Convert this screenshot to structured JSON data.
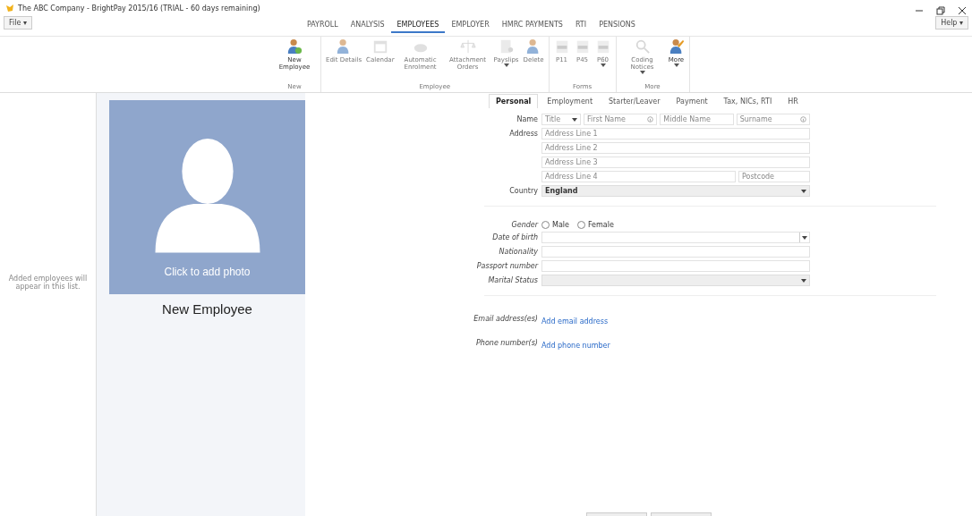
{
  "window": {
    "title": "The ABC Company - BrightPay 2015/16 (TRIAL - 60 days remaining)"
  },
  "file_menu": "File ▾",
  "help_menu": "Help ▾",
  "ribbon_tabs": [
    {
      "label": "PAYROLL",
      "selected": false
    },
    {
      "label": "ANALYSIS",
      "selected": false
    },
    {
      "label": "EMPLOYEES",
      "selected": true
    },
    {
      "label": "EMPLOYER",
      "selected": false
    },
    {
      "label": "HMRC PAYMENTS",
      "selected": false
    },
    {
      "label": "RTI",
      "selected": false
    },
    {
      "label": "PENSIONS",
      "selected": false
    }
  ],
  "ribbon_groups": [
    {
      "label": "New",
      "items": [
        {
          "label": "New Employee",
          "disabled": false,
          "dropdown": false
        }
      ]
    },
    {
      "label": "Employee",
      "items": [
        {
          "label": "Edit Details",
          "disabled": true,
          "dropdown": false
        },
        {
          "label": "Calendar",
          "disabled": true,
          "dropdown": false
        },
        {
          "label": "Automatic Enrolment",
          "disabled": true,
          "dropdown": false
        },
        {
          "label": "Attachment Orders",
          "disabled": true,
          "dropdown": false
        },
        {
          "label": "Payslips",
          "disabled": true,
          "dropdown": true
        },
        {
          "label": "Delete",
          "disabled": true,
          "dropdown": false
        }
      ]
    },
    {
      "label": "Forms",
      "items": [
        {
          "label": "P11",
          "disabled": true,
          "dropdown": false
        },
        {
          "label": "P45",
          "disabled": true,
          "dropdown": false
        },
        {
          "label": "P60",
          "disabled": true,
          "dropdown": true
        }
      ]
    },
    {
      "label": "More",
      "items": [
        {
          "label": "Coding Notices",
          "disabled": true,
          "dropdown": true
        },
        {
          "label": "More",
          "disabled": false,
          "dropdown": true
        }
      ]
    }
  ],
  "employee_list": {
    "empty_message": "Added employees will appear in this list."
  },
  "photo": {
    "prompt": "Click to add photo"
  },
  "employee_name": "New Employee",
  "form_tabs": [
    {
      "label": "Personal",
      "selected": true
    },
    {
      "label": "Employment",
      "selected": false
    },
    {
      "label": "Starter/Leaver",
      "selected": false
    },
    {
      "label": "Payment",
      "selected": false
    },
    {
      "label": "Tax, NICs, RTI",
      "selected": false
    },
    {
      "label": "HR",
      "selected": false
    }
  ],
  "name": {
    "label": "Name",
    "title_placeholder": "Title",
    "first_placeholder": "First Name",
    "middle_placeholder": "Middle Name",
    "surname_placeholder": "Surname"
  },
  "address": {
    "label": "Address",
    "lines": [
      "Address Line 1",
      "Address Line 2",
      "Address Line 3",
      "Address Line 4"
    ],
    "postcode_placeholder": "Postcode"
  },
  "country": {
    "label": "Country",
    "value": "England"
  },
  "gender": {
    "label": "Gender",
    "options": [
      {
        "label": "Male",
        "selected": false
      },
      {
        "label": "Female",
        "selected": false
      }
    ]
  },
  "details": [
    {
      "kind": "date",
      "label": "Date of birth"
    },
    {
      "kind": "text",
      "label": "Nationality"
    },
    {
      "kind": "text",
      "label": "Passport number"
    },
    {
      "kind": "select",
      "label": "Marital Status"
    }
  ],
  "contacts": [
    {
      "label": "Email address(es)",
      "link": "Add email address"
    },
    {
      "label": "Phone number(s)",
      "link": "Add phone number"
    }
  ]
}
